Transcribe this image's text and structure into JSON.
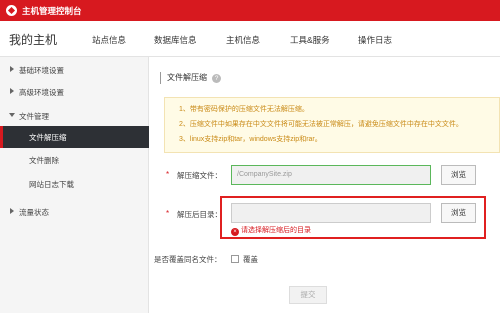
{
  "topbar": {
    "title": "主机管理控制台"
  },
  "nav": {
    "host_title": "我的主机",
    "items": [
      "站点信息",
      "数据库信息",
      "主机信息",
      "工具&服务",
      "操作日志"
    ]
  },
  "sidebar": {
    "items": [
      {
        "label": "基础环境设置"
      },
      {
        "label": "高级环境设置"
      },
      {
        "label": "文件管理"
      }
    ],
    "sub_items": [
      {
        "label": "文件解压缩",
        "active": true
      },
      {
        "label": "文件删除"
      },
      {
        "label": "网站日志下载"
      }
    ],
    "last_item": {
      "label": "流量状态"
    }
  },
  "content": {
    "section_title": "文件解压缩",
    "notice": [
      "1、带有密码保护的压缩文件无法解压缩。",
      "2、压缩文件中如果存在中文文件将可能无法被正常解压，请避免压缩文件中存在中文文件。",
      "3、linux支持zip和tar，windows支持zip和rar。"
    ],
    "zip_file": {
      "label": "解压缩文件：",
      "value": "/CompanySite.zip",
      "browse": "浏览"
    },
    "target_dir": {
      "label": "解压后目录：",
      "value": "",
      "browse": "浏览",
      "error": "请选择解压缩后的目录"
    },
    "overwrite": {
      "label": "是否覆盖同名文件：",
      "option": "覆盖"
    },
    "submit": "提交"
  }
}
